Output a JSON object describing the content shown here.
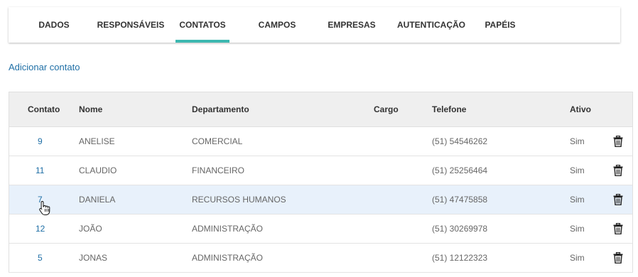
{
  "tabs": [
    {
      "label": "DADOS"
    },
    {
      "label": "RESPONSÁVEIS"
    },
    {
      "label": "CONTATOS"
    },
    {
      "label": "CAMPOS"
    },
    {
      "label": "EMPRESAS"
    },
    {
      "label": "AUTENTICAÇÃO"
    },
    {
      "label": "PAPÉIS"
    }
  ],
  "active_tab": "CONTATOS",
  "accent_color": "#3db8b0",
  "link_color": "#1f6fa6",
  "add_contact_label": "Adicionar contato",
  "table": {
    "columns": {
      "contato": "Contato",
      "nome": "Nome",
      "departamento": "Departamento",
      "cargo": "Cargo",
      "telefone": "Telefone",
      "ativo": "Ativo"
    },
    "rows": [
      {
        "id": "9",
        "nome": "ANELISE",
        "departamento": "COMERCIAL",
        "cargo": "",
        "telefone": "(51) 54546262",
        "ativo": "Sim"
      },
      {
        "id": "11",
        "nome": "CLAUDIO",
        "departamento": "FINANCEIRO",
        "cargo": "",
        "telefone": "(51) 25256464",
        "ativo": "Sim"
      },
      {
        "id": "7",
        "nome": "DANIELA",
        "departamento": "RECURSOS HUMANOS",
        "cargo": "",
        "telefone": "(51) 47475858",
        "ativo": "Sim"
      },
      {
        "id": "12",
        "nome": "JOÃO",
        "departamento": "ADMINISTRAÇÃO",
        "cargo": "",
        "telefone": "(51) 30269978",
        "ativo": "Sim"
      },
      {
        "id": "5",
        "nome": "JONAS",
        "departamento": "ADMINISTRAÇÃO",
        "cargo": "",
        "telefone": "(51) 12122323",
        "ativo": "Sim"
      }
    ],
    "row_icon": "trash-icon",
    "highlighted_row": "7"
  },
  "pointer_icon": "hand-pointer-icon"
}
